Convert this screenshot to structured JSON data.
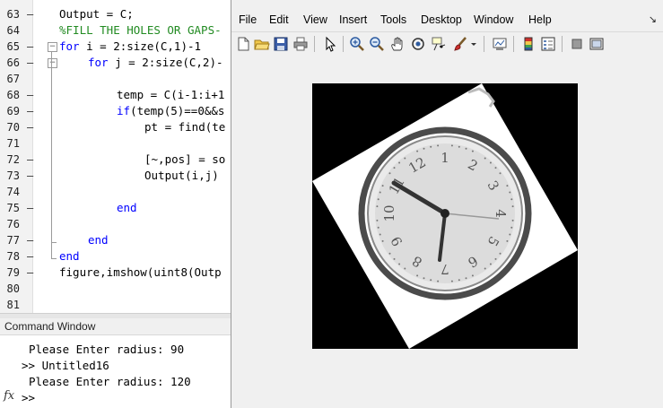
{
  "editor": {
    "lines": [
      {
        "num": "63",
        "code": "Output = C;"
      },
      {
        "num": "64",
        "code": "%FILL THE HOLES OR GAPS-"
      },
      {
        "num": "65",
        "kw": "for",
        "code": " i = 2:size(C,1)-1"
      },
      {
        "num": "66",
        "kw": "for",
        "code": " j = 2:size(C,2)-"
      },
      {
        "num": "67",
        "code": ""
      },
      {
        "num": "68",
        "code": "temp = C(i-1:i+1"
      },
      {
        "num": "69",
        "kw": "if",
        "code": "(temp(5)==0&&s"
      },
      {
        "num": "70",
        "code": "pt = find(te"
      },
      {
        "num": "71",
        "code": ""
      },
      {
        "num": "72",
        "code": "[~,pos] = so"
      },
      {
        "num": "73",
        "code": "Output(i,j)"
      },
      {
        "num": "74",
        "code": ""
      },
      {
        "num": "75",
        "kw": "end",
        "code": ""
      },
      {
        "num": "76",
        "code": ""
      },
      {
        "num": "77",
        "kw": "end",
        "code": ""
      },
      {
        "num": "78",
        "kw": "end",
        "code": ""
      },
      {
        "num": "79",
        "code": "figure,imshow(uint8(Outp"
      },
      {
        "num": "80",
        "code": ""
      },
      {
        "num": "81",
        "code": ""
      }
    ]
  },
  "command_window": {
    "title": "Command Window",
    "lines": [
      "Please Enter radius: 90",
      ">> Untitled16",
      "Please Enter radius: 120"
    ],
    "prompt": ">>",
    "fx_label": "fx"
  },
  "figure": {
    "menu": [
      "File",
      "Edit",
      "View",
      "Insert",
      "Tools",
      "Desktop",
      "Window",
      "Help"
    ],
    "dock_arrow": "↘",
    "toolbar_icons": [
      "new-figure-icon",
      "open-file-icon",
      "save-icon",
      "print-icon",
      "pointer-icon",
      "zoom-in-icon",
      "zoom-out-icon",
      "pan-icon",
      "rotate-3d-icon",
      "data-cursor-icon",
      "brush-icon",
      "brush-dropdown-icon",
      "link-plot-icon",
      "colorbar-icon",
      "legend-icon",
      "hide-plot-tools-icon",
      "show-plot-tools-icon"
    ],
    "clock_numerals": [
      "10",
      "11",
      "12",
      "1",
      "2",
      "3",
      "4",
      "5",
      "6",
      "7",
      "8",
      "9"
    ],
    "colors": {
      "keyword": "#0000ff",
      "comment": "#228b22",
      "figure_bg": "#f0f0f0",
      "image_bg": "#000000"
    }
  }
}
